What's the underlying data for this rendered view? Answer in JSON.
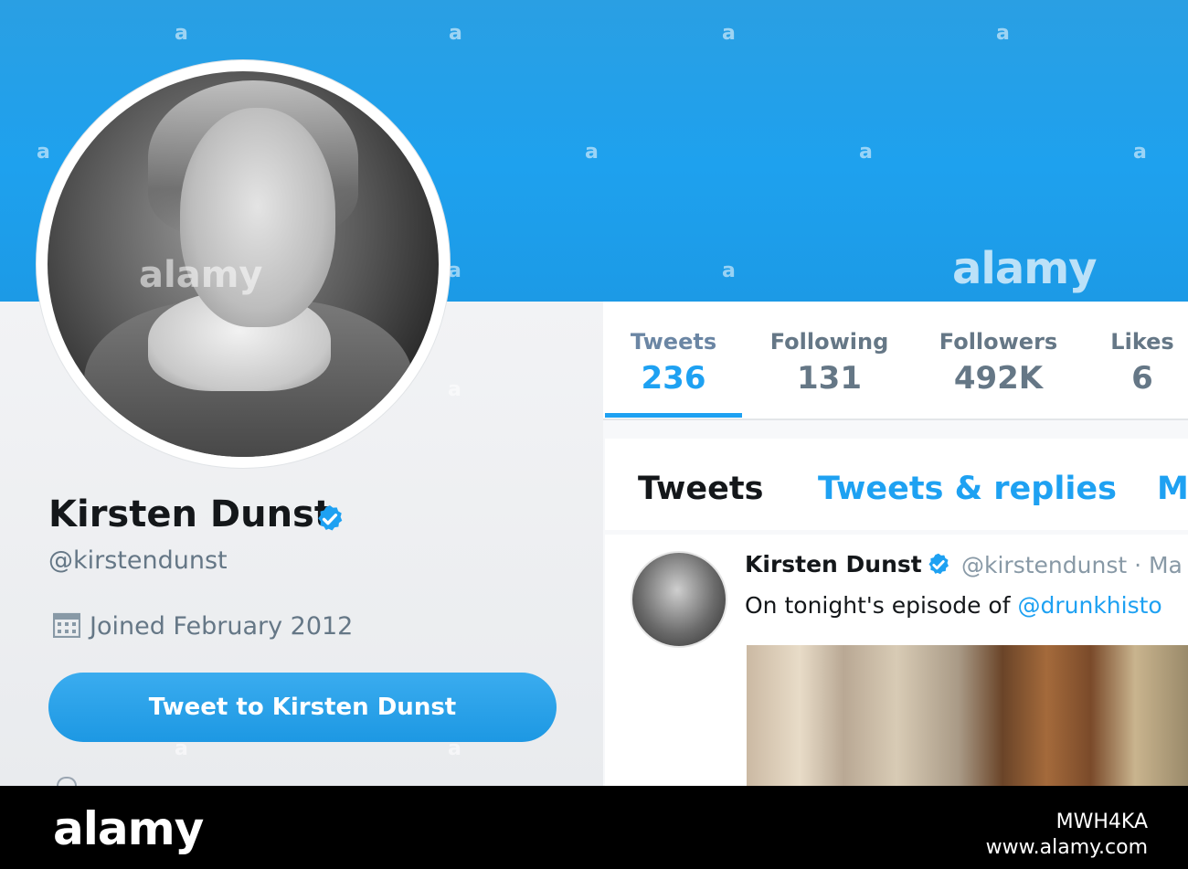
{
  "profile": {
    "name": "Kirsten Dunst",
    "handle": "@kirstendunst",
    "joined": "Joined February 2012",
    "tweet_button": "Tweet to Kirsten Dunst"
  },
  "stats": [
    {
      "label": "Tweets",
      "value": "236"
    },
    {
      "label": "Following",
      "value": "131"
    },
    {
      "label": "Followers",
      "value": "492K"
    },
    {
      "label": "Likes",
      "value": "6"
    }
  ],
  "tabs": {
    "tweets": "Tweets",
    "replies": "Tweets & replies",
    "media_partial": "M"
  },
  "tweet": {
    "author": "Kirsten Dunst",
    "handle": "@kirstendunst · Ma",
    "text": "On tonight's episode of ",
    "mention": "@drunkhisto"
  },
  "watermark": {
    "small": "a",
    "brand": "alamy",
    "image_id": "MWH4KA",
    "url": "www.alamy.com"
  },
  "colors": {
    "twitter_blue": "#1ea1f2",
    "text_dark": "#14171a",
    "text_grey": "#657786"
  },
  "icons": {
    "verified": "verified-badge-icon",
    "calendar": "calendar-icon"
  }
}
